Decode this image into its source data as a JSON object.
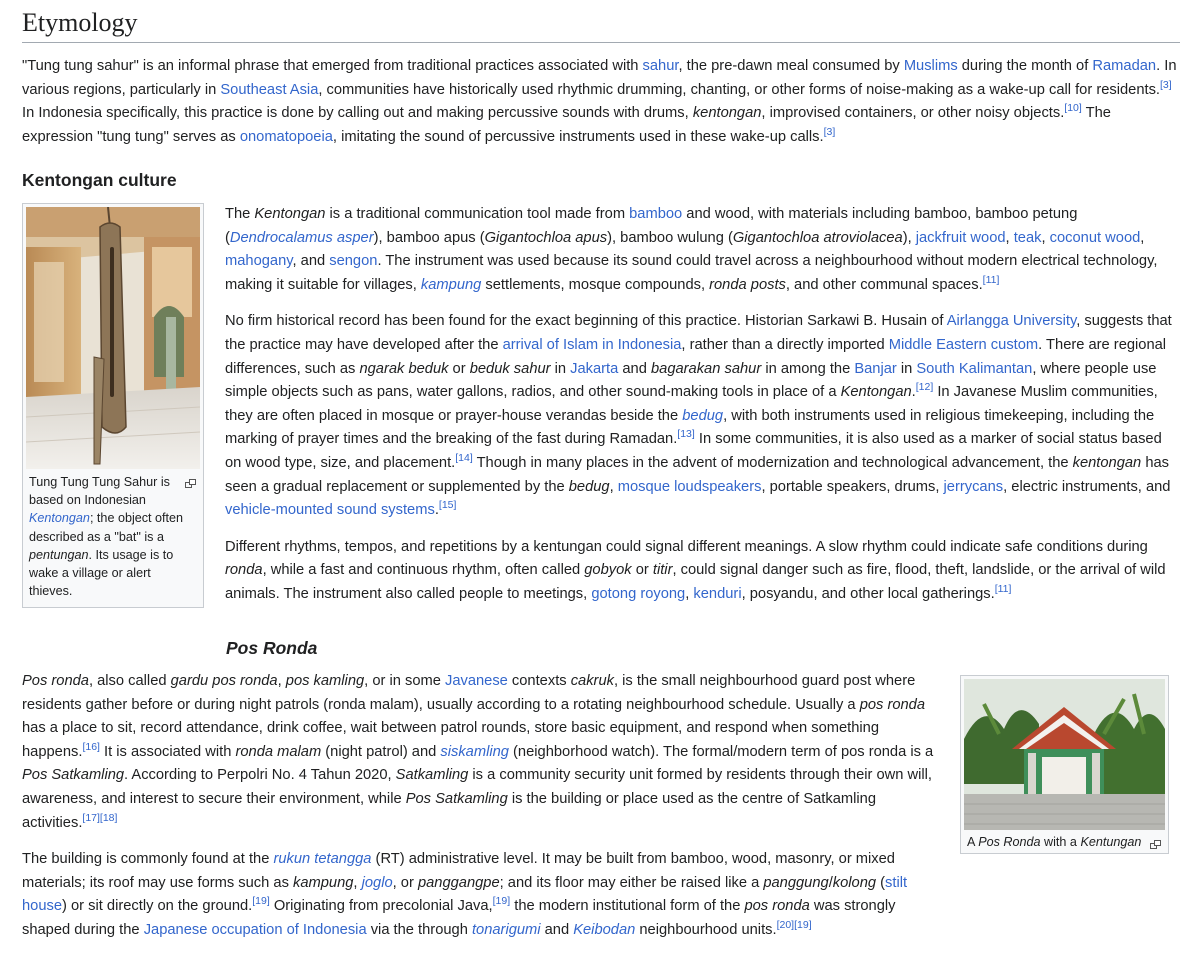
{
  "etymology": {
    "heading": "Etymology",
    "p1": [
      {
        "t": "\"Tung tung sahur\" is an informal phrase that emerged from traditional practices associated with "
      },
      {
        "t": "sahur",
        "l": 1
      },
      {
        "t": ", the pre-dawn meal consumed by "
      },
      {
        "t": "Muslims",
        "l": 1
      },
      {
        "t": " during the month of "
      },
      {
        "t": "Ramadan",
        "l": 1
      },
      {
        "t": ". In various regions, particularly in "
      },
      {
        "t": "Southeast Asia",
        "l": 1
      },
      {
        "t": ", communities have historically used rhythmic drumming, chanting, or other forms of noise-making as a wake-up call for residents."
      },
      {
        "t": "[3]",
        "s": 1
      },
      {
        "t": " In Indonesia specifically, this practice is done by calling out and making percussive sounds with drums, "
      },
      {
        "t": "kentongan",
        "i": 1
      },
      {
        "t": ", improvised containers, or other noisy objects."
      },
      {
        "t": "[10]",
        "s": 1
      },
      {
        "t": " The expression \"tung tung\" serves as "
      },
      {
        "t": "onomatopoeia",
        "l": 1
      },
      {
        "t": ", imitating the sound of percussive instruments used in these wake-up calls."
      },
      {
        "t": "[3]",
        "s": 1
      }
    ]
  },
  "kentongan": {
    "heading": "Kentongan culture",
    "thumb_caption": [
      {
        "t": "Tung Tung Tung Sahur is based on Indonesian "
      },
      {
        "t": "Kentongan",
        "l": 1,
        "i": 1
      },
      {
        "t": "; the object often described as a \"bat\" is a "
      },
      {
        "t": "pentungan",
        "i": 1
      },
      {
        "t": ". Its usage is to wake a village or alert thieves."
      }
    ],
    "p1": [
      {
        "t": "The "
      },
      {
        "t": "Kentongan",
        "i": 1
      },
      {
        "t": " is a traditional communication tool made from "
      },
      {
        "t": "bamboo",
        "l": 1
      },
      {
        "t": " and wood, with materials including bamboo, bamboo petung ("
      },
      {
        "t": "Dendrocalamus asper",
        "l": 1,
        "i": 1
      },
      {
        "t": "), bamboo apus ("
      },
      {
        "t": "Gigantochloa apus",
        "i": 1
      },
      {
        "t": "), bamboo wulung ("
      },
      {
        "t": "Gigantochloa atroviolacea",
        "i": 1
      },
      {
        "t": "), "
      },
      {
        "t": "jackfruit wood",
        "l": 1
      },
      {
        "t": ", "
      },
      {
        "t": "teak",
        "l": 1
      },
      {
        "t": ", "
      },
      {
        "t": "coconut wood",
        "l": 1
      },
      {
        "t": ", "
      },
      {
        "t": "mahogany",
        "l": 1
      },
      {
        "t": ", and "
      },
      {
        "t": "sengon",
        "l": 1
      },
      {
        "t": ". The instrument was used because its sound could travel across a neighbourhood without modern electrical technology, making it suitable for villages, "
      },
      {
        "t": "kampung",
        "l": 1,
        "i": 1
      },
      {
        "t": " settlements, mosque compounds, "
      },
      {
        "t": "ronda posts",
        "i": 1
      },
      {
        "t": ", and other communal spaces."
      },
      {
        "t": "[11]",
        "s": 1
      }
    ],
    "p2": [
      {
        "t": "No firm historical record has been found for the exact beginning of this practice. Historian Sarkawi B. Husain of "
      },
      {
        "t": "Airlangga University",
        "l": 1
      },
      {
        "t": ", suggests that the practice may have developed after the "
      },
      {
        "t": "arrival of Islam in Indonesia",
        "l": 1
      },
      {
        "t": ", rather than a directly imported "
      },
      {
        "t": "Middle Eastern custom",
        "l": 1
      },
      {
        "t": ". There are regional differences, such as "
      },
      {
        "t": "ngarak beduk",
        "i": 1
      },
      {
        "t": " or "
      },
      {
        "t": "beduk sahur",
        "i": 1
      },
      {
        "t": " in "
      },
      {
        "t": "Jakarta",
        "l": 1
      },
      {
        "t": " and "
      },
      {
        "t": "bagarakan sahur",
        "i": 1
      },
      {
        "t": " in among the "
      },
      {
        "t": "Banjar",
        "l": 1
      },
      {
        "t": " in "
      },
      {
        "t": "South Kalimantan",
        "l": 1
      },
      {
        "t": ", where people use simple objects such as pans, water gallons, radios, and other sound-making tools in place of a "
      },
      {
        "t": "Kentongan",
        "i": 1
      },
      {
        "t": "."
      },
      {
        "t": "[12]",
        "s": 1
      },
      {
        "t": " In Javanese Muslim communities, they are often placed in mosque or prayer-house verandas beside the "
      },
      {
        "t": "bedug",
        "l": 1,
        "i": 1
      },
      {
        "t": ", with both instruments used in religious timekeeping, including the marking of prayer times and the breaking of the fast during Ramadan."
      },
      {
        "t": "[13]",
        "s": 1
      },
      {
        "t": " In some communities, it is also used as a marker of social status based on wood type, size, and placement."
      },
      {
        "t": "[14]",
        "s": 1
      },
      {
        "t": " Though in many places in the advent of modernization and technological advancement, the "
      },
      {
        "t": "kentongan",
        "i": 1
      },
      {
        "t": " has seen a gradual replacement or supplemented by the "
      },
      {
        "t": "bedug",
        "i": 1
      },
      {
        "t": ", "
      },
      {
        "t": "mosque loudspeakers",
        "l": 1
      },
      {
        "t": ", portable speakers, drums, "
      },
      {
        "t": "jerrycans",
        "l": 1
      },
      {
        "t": ", electric instruments, and "
      },
      {
        "t": "vehicle-mounted sound systems",
        "l": 1
      },
      {
        "t": "."
      },
      {
        "t": "[15]",
        "s": 1
      }
    ],
    "p3": [
      {
        "t": "Different rhythms, tempos, and repetitions by a kentungan could signal different meanings. A slow rhythm could indicate safe conditions during "
      },
      {
        "t": "ronda",
        "i": 1
      },
      {
        "t": ", while a fast and continuous rhythm, often called "
      },
      {
        "t": "gobyok",
        "i": 1
      },
      {
        "t": " or "
      },
      {
        "t": "titir",
        "i": 1
      },
      {
        "t": ", could signal danger such as fire, flood, theft, landslide, or the arrival of wild animals. The instrument also called people to meetings, "
      },
      {
        "t": "gotong royong",
        "l": 1
      },
      {
        "t": ", "
      },
      {
        "t": "kenduri",
        "l": 1
      },
      {
        "t": ", posyandu, and other local gatherings."
      },
      {
        "t": "[11]",
        "s": 1
      }
    ]
  },
  "pos_ronda": {
    "heading": "Pos Ronda",
    "thumb_caption": [
      {
        "t": "A "
      },
      {
        "t": "Pos Ronda",
        "i": 1
      },
      {
        "t": " with a "
      },
      {
        "t": "Kentungan",
        "i": 1
      }
    ],
    "p1": [
      {
        "t": "Pos ronda",
        "i": 1
      },
      {
        "t": ", also called "
      },
      {
        "t": "gardu pos ronda",
        "i": 1
      },
      {
        "t": ", "
      },
      {
        "t": "pos kamling",
        "i": 1
      },
      {
        "t": ", or in some "
      },
      {
        "t": "Javanese",
        "l": 1
      },
      {
        "t": " contexts "
      },
      {
        "t": "cakruk",
        "i": 1
      },
      {
        "t": ", is the small neighbourhood guard post where residents gather before or during night patrols (ronda malam), usually according to a rotating neighbourhood schedule. Usually a "
      },
      {
        "t": "pos ronda",
        "i": 1
      },
      {
        "t": " has a place to sit, record attendance, drink coffee, wait between patrol rounds, store basic equipment, and respond when something happens."
      },
      {
        "t": "[16]",
        "s": 1
      },
      {
        "t": " It is associated with "
      },
      {
        "t": "ronda malam",
        "i": 1
      },
      {
        "t": " (night patrol) and "
      },
      {
        "t": "siskamling",
        "l": 1,
        "i": 1
      },
      {
        "t": " (neighborhood watch). The formal/modern term of pos ronda is a "
      },
      {
        "t": "Pos Satkamling",
        "i": 1
      },
      {
        "t": ". According to Perpolri No. 4 Tahun 2020, "
      },
      {
        "t": "Satkamling",
        "i": 1
      },
      {
        "t": " is a community security unit formed by residents through their own will, awareness, and interest to secure their environment, while "
      },
      {
        "t": "Pos Satkamling",
        "i": 1
      },
      {
        "t": " is the building or place used as the centre of Satkamling activities."
      },
      {
        "t": "[17]",
        "s": 1
      },
      {
        "t": "[18]",
        "s": 1
      }
    ],
    "p2": [
      {
        "t": "The building is commonly found at the "
      },
      {
        "t": "rukun tetangga",
        "l": 1,
        "i": 1
      },
      {
        "t": " (RT) administrative level. It may be built from bamboo, wood, masonry, or mixed materials; its roof may use forms such as "
      },
      {
        "t": "kampung",
        "i": 1
      },
      {
        "t": ", "
      },
      {
        "t": "joglo",
        "l": 1,
        "i": 1
      },
      {
        "t": ", or "
      },
      {
        "t": "panggangpe",
        "i": 1
      },
      {
        "t": "; and its floor may either be raised like a "
      },
      {
        "t": "panggung",
        "i": 1
      },
      {
        "t": "/"
      },
      {
        "t": "kolong",
        "i": 1
      },
      {
        "t": " ("
      },
      {
        "t": "stilt house",
        "l": 1
      },
      {
        "t": ") or sit directly on the ground."
      },
      {
        "t": "[19]",
        "s": 1
      },
      {
        "t": " Originating from precolonial Java,"
      },
      {
        "t": "[19]",
        "s": 1
      },
      {
        "t": " the modern institutional form of the "
      },
      {
        "t": "pos ronda",
        "i": 1
      },
      {
        "t": " was strongly shaped during the "
      },
      {
        "t": "Japanese occupation of Indonesia",
        "l": 1
      },
      {
        "t": " via the through "
      },
      {
        "t": "tonarigumi",
        "l": 1,
        "i": 1
      },
      {
        "t": " and "
      },
      {
        "t": "Keibodan",
        "l": 1,
        "i": 1
      },
      {
        "t": " neighbourhood units."
      },
      {
        "t": "[20]",
        "s": 1
      },
      {
        "t": "[19]",
        "s": 1
      }
    ]
  }
}
